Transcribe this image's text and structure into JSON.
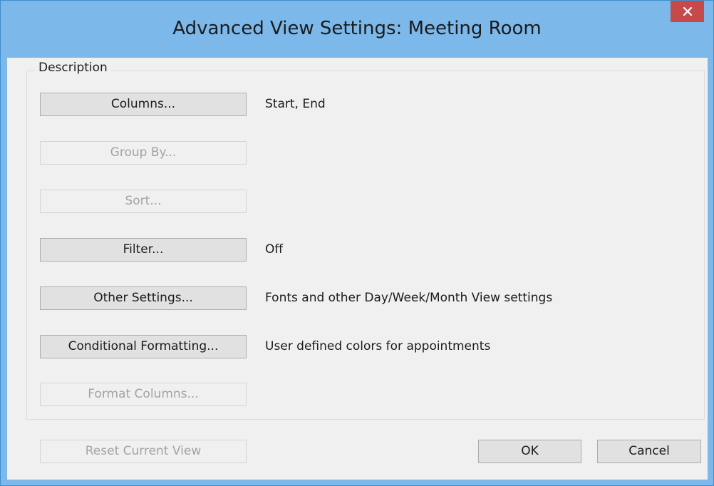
{
  "window": {
    "title": "Advanced View Settings: Meeting Room"
  },
  "group": {
    "legend": "Description"
  },
  "rows": [
    {
      "label": "Columns...",
      "description": "Start, End",
      "enabled": true
    },
    {
      "label": "Group By...",
      "description": "",
      "enabled": false
    },
    {
      "label": "Sort...",
      "description": "",
      "enabled": false
    },
    {
      "label": "Filter...",
      "description": "Off",
      "enabled": true
    },
    {
      "label": "Other Settings...",
      "description": "Fonts and other Day/Week/Month View settings",
      "enabled": true
    },
    {
      "label": "Conditional Formatting...",
      "description": "User defined colors for appointments",
      "enabled": true
    },
    {
      "label": "Format Columns...",
      "description": "",
      "enabled": false
    }
  ],
  "footer": {
    "reset_label": "Reset Current View",
    "ok_label": "OK",
    "cancel_label": "Cancel"
  },
  "colors": {
    "titlebar": "#7cb8ea",
    "close_button": "#c74a4a",
    "dialog_background": "#f0f0f0",
    "button_face": "#e1e1e1",
    "disabled_text": "#a3a3a3"
  },
  "icons": {
    "close": "close-icon"
  }
}
